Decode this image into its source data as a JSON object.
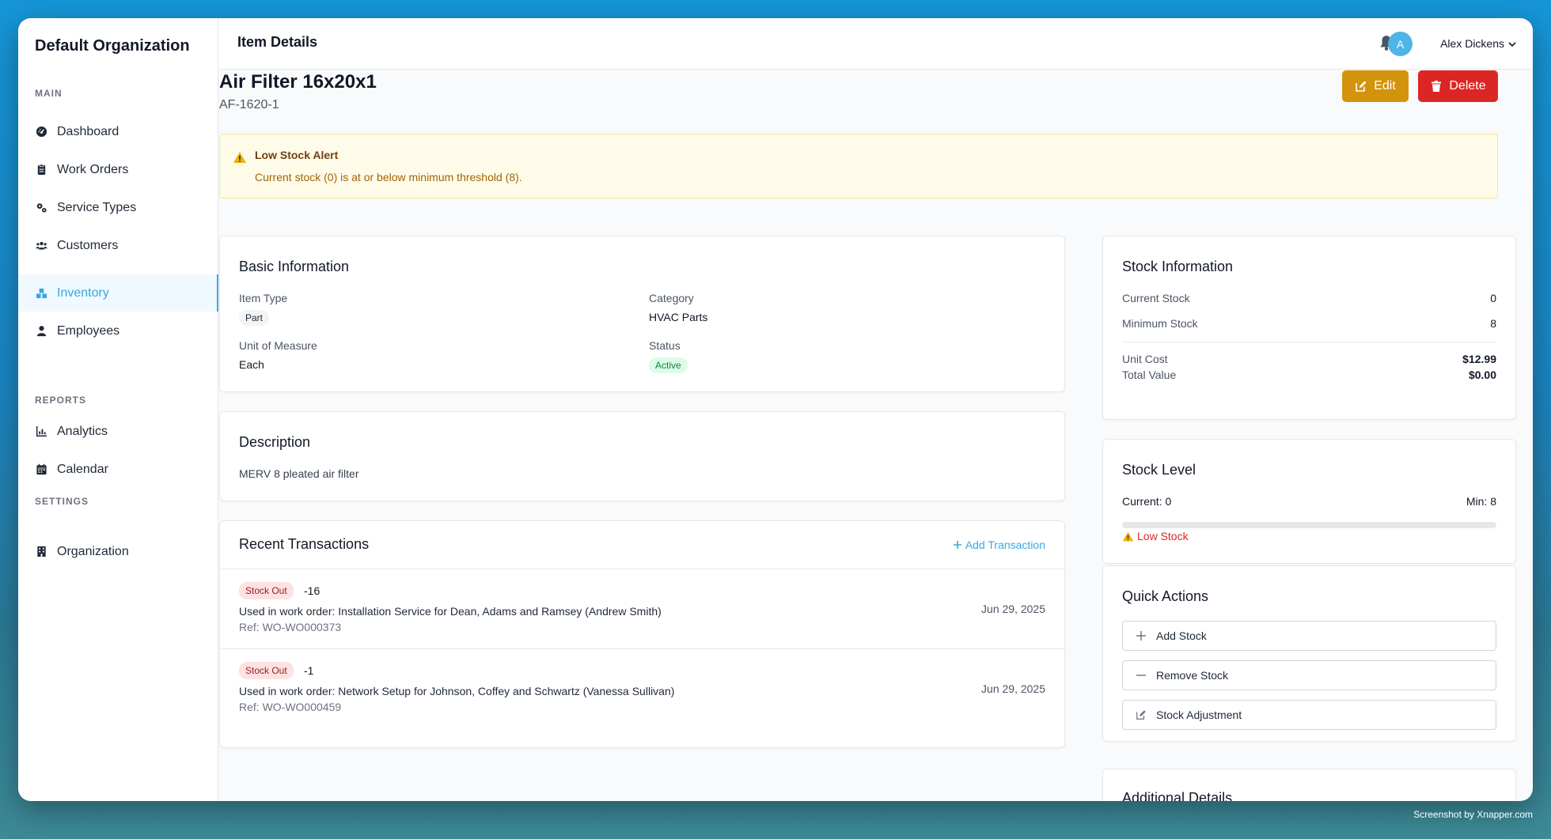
{
  "app": {
    "org_name": "Default Organization",
    "page_title": "Item Details",
    "user": {
      "initial": "A",
      "name": "Alex Dickens"
    }
  },
  "sidebar": {
    "sections": [
      {
        "label": "MAIN"
      },
      {
        "label": "REPORTS"
      },
      {
        "label": "SETTINGS"
      }
    ],
    "items": [
      {
        "label": "Dashboard",
        "icon": "dashboard-icon"
      },
      {
        "label": "Work Orders",
        "icon": "clipboard-icon"
      },
      {
        "label": "Service Types",
        "icon": "gears-icon"
      },
      {
        "label": "Customers",
        "icon": "users-icon"
      },
      {
        "label": "Inventory",
        "icon": "boxes-icon",
        "active": true
      },
      {
        "label": "Employees",
        "icon": "user-icon"
      },
      {
        "label": "Analytics",
        "icon": "chart-icon"
      },
      {
        "label": "Calendar",
        "icon": "calendar-icon"
      },
      {
        "label": "Organization",
        "icon": "building-icon"
      }
    ]
  },
  "item": {
    "name": "Air Filter 16x20x1",
    "sku": "AF-1620-1",
    "edit_label": "Edit",
    "delete_label": "Delete"
  },
  "alert": {
    "title": "Low Stock Alert",
    "message": "Current stock (0) is at or below minimum threshold (8)."
  },
  "basic_info": {
    "title": "Basic Information",
    "item_type_label": "Item Type",
    "item_type": "Part",
    "category_label": "Category",
    "category": "HVAC Parts",
    "uom_label": "Unit of Measure",
    "uom": "Each",
    "status_label": "Status",
    "status": "Active"
  },
  "description": {
    "title": "Description",
    "text": "MERV 8 pleated air filter"
  },
  "transactions": {
    "title": "Recent Transactions",
    "add_label": "Add Transaction",
    "rows": [
      {
        "type": "Stock Out",
        "qty": "-16",
        "desc": "Used in work order: Installation Service for Dean, Adams and Ramsey (Andrew Smith)",
        "ref": "Ref: WO-WO000373",
        "date": "Jun 29, 2025"
      },
      {
        "type": "Stock Out",
        "qty": "-1",
        "desc": "Used in work order: Network Setup for Johnson, Coffey and Schwartz (Vanessa Sullivan)",
        "ref": "Ref: WO-WO000459",
        "date": "Jun 29, 2025"
      }
    ]
  },
  "stock_info": {
    "title": "Stock Information",
    "current_label": "Current Stock",
    "current": "0",
    "minimum_label": "Minimum Stock",
    "minimum": "8",
    "unit_cost_label": "Unit Cost",
    "unit_cost": "$12.99",
    "total_value_label": "Total Value",
    "total_value": "$0.00"
  },
  "stock_level": {
    "title": "Stock Level",
    "current_text": "Current: 0",
    "min_text": "Min: 8",
    "fill_fraction": 0,
    "status_text": "Low Stock",
    "status_color": "#dc2626"
  },
  "quick_actions": {
    "title": "Quick Actions",
    "add_label": "Add Stock",
    "remove_label": "Remove Stock",
    "adjust_label": "Stock Adjustment"
  },
  "additional": {
    "title": "Additional Details"
  },
  "watermark": "Screenshot by Xnapper.com",
  "colors": {
    "accent": "#38a8dc",
    "edit": "#d4930d",
    "delete": "#dc2626"
  }
}
